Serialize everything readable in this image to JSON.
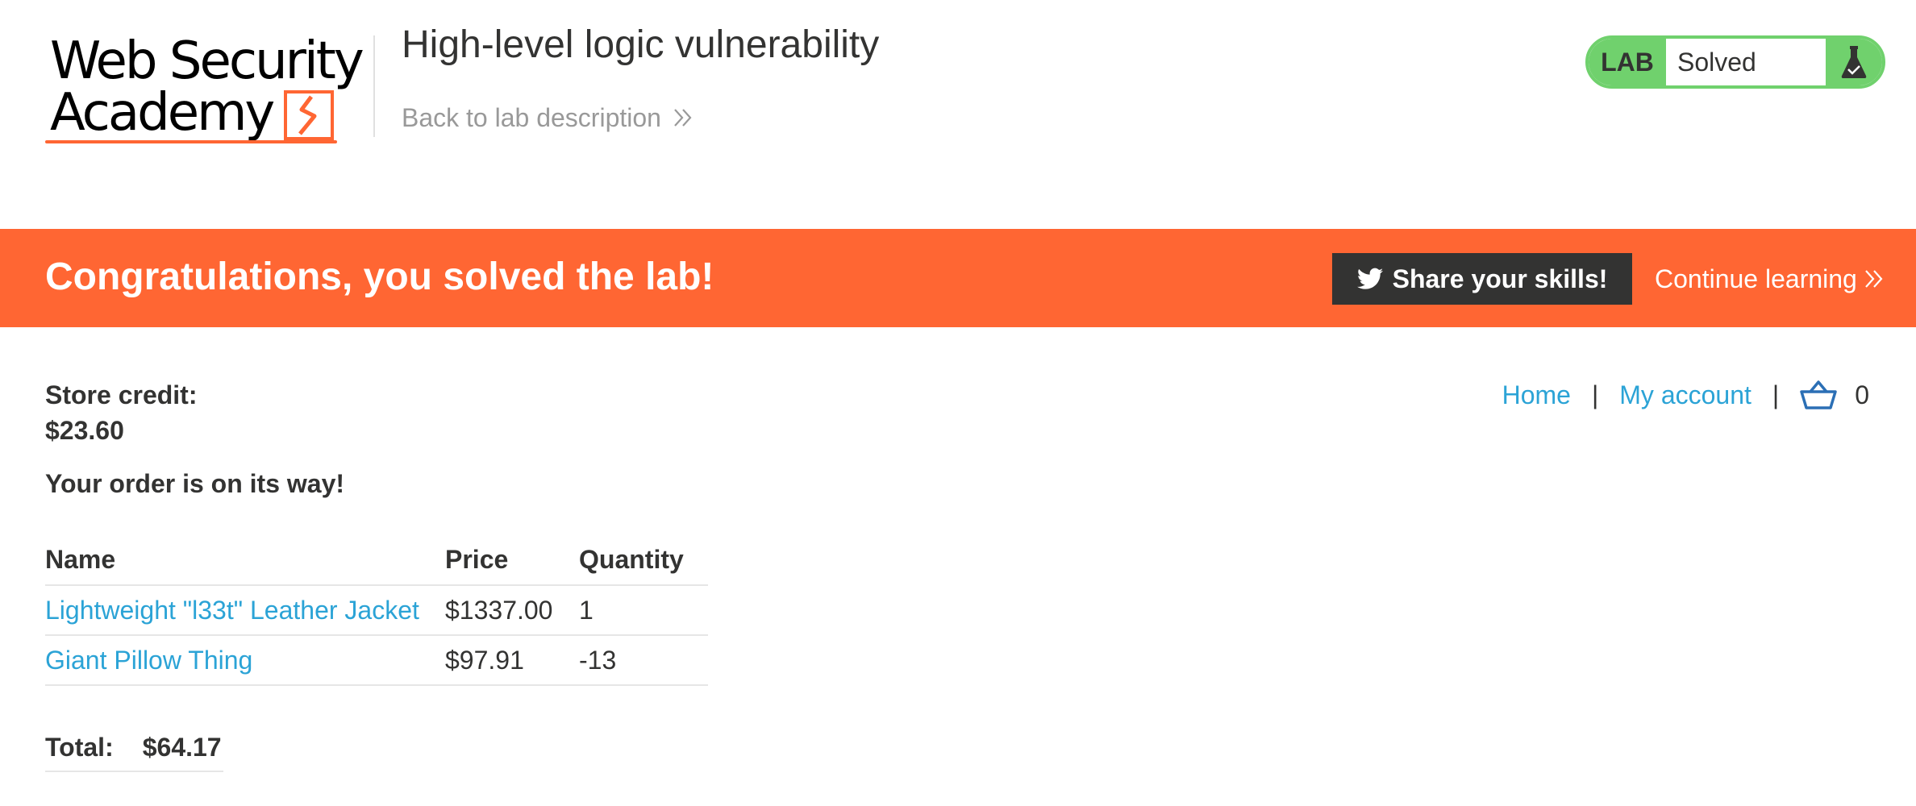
{
  "header": {
    "logo": {
      "line1": "Web Security",
      "line2": "Academy"
    },
    "lab_title": "High-level logic vulnerability",
    "back_link": "Back to lab description",
    "lab_status": {
      "label": "LAB",
      "state": "Solved"
    }
  },
  "banner": {
    "message": "Congratulations, you solved the lab!",
    "share_button": "Share your skills!",
    "continue_link": "Continue learning"
  },
  "nav": {
    "home": "Home",
    "separator": "|",
    "my_account": "My account",
    "cart_count": "0"
  },
  "account": {
    "credit_label": "Store credit:",
    "credit_value": "$23.60",
    "order_message": "Your order is on its way!"
  },
  "order_table": {
    "headers": [
      "Name",
      "Price",
      "Quantity"
    ],
    "rows": [
      [
        "Lightweight \"l33t\" Leather Jacket",
        "$1337.00",
        "1"
      ],
      [
        "Giant Pillow Thing",
        "$97.91",
        "-13"
      ]
    ]
  },
  "total": {
    "label": "Total:",
    "value": "$64.17"
  },
  "colors": {
    "accent_orange": "#ff6633",
    "link_blue": "#2ba3d6",
    "status_green": "#70d16d",
    "text_dark": "#333332"
  },
  "icons": [
    "double-chevron-right-icon",
    "flask-icon",
    "twitter-icon",
    "cart-icon"
  ]
}
